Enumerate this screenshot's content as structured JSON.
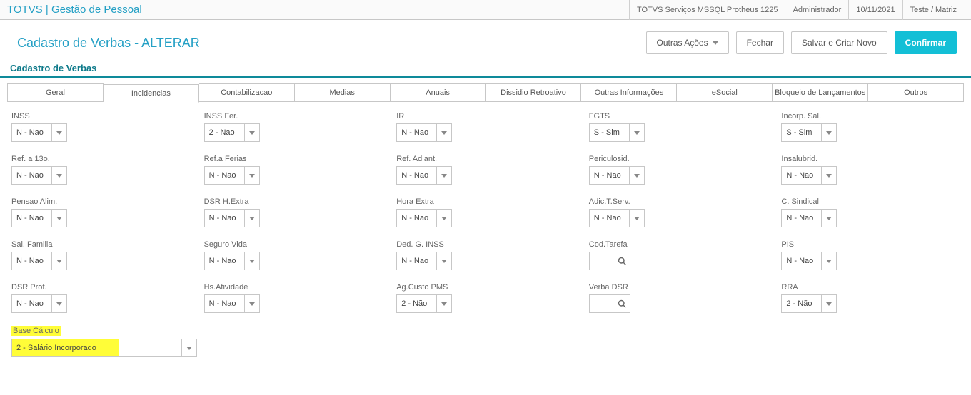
{
  "topbar": {
    "title": "TOTVS | Gestão de Pessoal",
    "meta": [
      "TOTVS Serviços MSSQL Protheus 1225",
      "Administrador",
      "10/11/2021",
      "Teste / Matriz"
    ]
  },
  "header": {
    "title": "Cadastro de Verbas - ALTERAR",
    "actions": {
      "other": "Outras Ações",
      "close": "Fechar",
      "save_new": "Salvar e Criar Novo",
      "confirm": "Confirmar"
    }
  },
  "section": {
    "title": "Cadastro de Verbas"
  },
  "tabs": [
    "Geral",
    "Incidencias",
    "Contabilizacao",
    "Medias",
    "Anuais",
    "Dissidio Retroativo",
    "Outras Informações",
    "eSocial",
    "Bloqueio de Lançamentos",
    "Outros"
  ],
  "active_tab": 1,
  "fields": {
    "r1": {
      "inss": {
        "label": "INSS",
        "value": "N - Nao"
      },
      "inss_fer": {
        "label": "INSS Fer.",
        "value": "2 - Nao"
      },
      "ir": {
        "label": "IR",
        "value": "N - Nao"
      },
      "fgts": {
        "label": "FGTS",
        "value": "S - Sim"
      },
      "incorp_sal": {
        "label": "Incorp. Sal.",
        "value": "S - Sim"
      }
    },
    "r2": {
      "ref_13": {
        "label": "Ref. a 13o.",
        "value": "N - Nao"
      },
      "ref_ferias": {
        "label": "Ref.a Ferias",
        "value": "N - Nao"
      },
      "ref_adiant": {
        "label": "Ref. Adiant.",
        "value": "N - Nao"
      },
      "periculosid": {
        "label": "Periculosid.",
        "value": "N - Nao"
      },
      "insalubrid": {
        "label": "Insalubrid.",
        "value": "N - Nao"
      }
    },
    "r3": {
      "pensao_alim": {
        "label": "Pensao Alim.",
        "value": "N - Nao"
      },
      "dsr_hextra": {
        "label": "DSR H.Extra",
        "value": "N - Nao"
      },
      "hora_extra": {
        "label": "Hora Extra",
        "value": "N - Nao"
      },
      "adic_tserv": {
        "label": "Adic.T.Serv.",
        "value": "N - Nao"
      },
      "c_sindical": {
        "label": "C. Sindical",
        "value": "N - Nao"
      }
    },
    "r4": {
      "sal_familia": {
        "label": "Sal. Familia",
        "value": "N - Nao"
      },
      "seguro_vida": {
        "label": "Seguro Vida",
        "value": "N - Nao"
      },
      "ded_g_inss": {
        "label": "Ded. G. INSS",
        "value": "N - Nao"
      },
      "cod_tarefa": {
        "label": "Cod.Tarefa",
        "value": ""
      },
      "pis": {
        "label": "PIS",
        "value": "N - Nao"
      }
    },
    "r5": {
      "dsr_prof": {
        "label": "DSR Prof.",
        "value": "N - Nao"
      },
      "hs_ativ": {
        "label": "Hs.Atividade",
        "value": "N - Nao"
      },
      "ag_custo": {
        "label": "Ag.Custo PMS",
        "value": "2 - Não"
      },
      "verba_dsr": {
        "label": "Verba DSR",
        "value": ""
      },
      "rra": {
        "label": "RRA",
        "value": "2 - Não"
      }
    },
    "r6": {
      "base_calc": {
        "label": "Base Cálculo",
        "value": "2 - Salário Incorporado"
      }
    }
  }
}
